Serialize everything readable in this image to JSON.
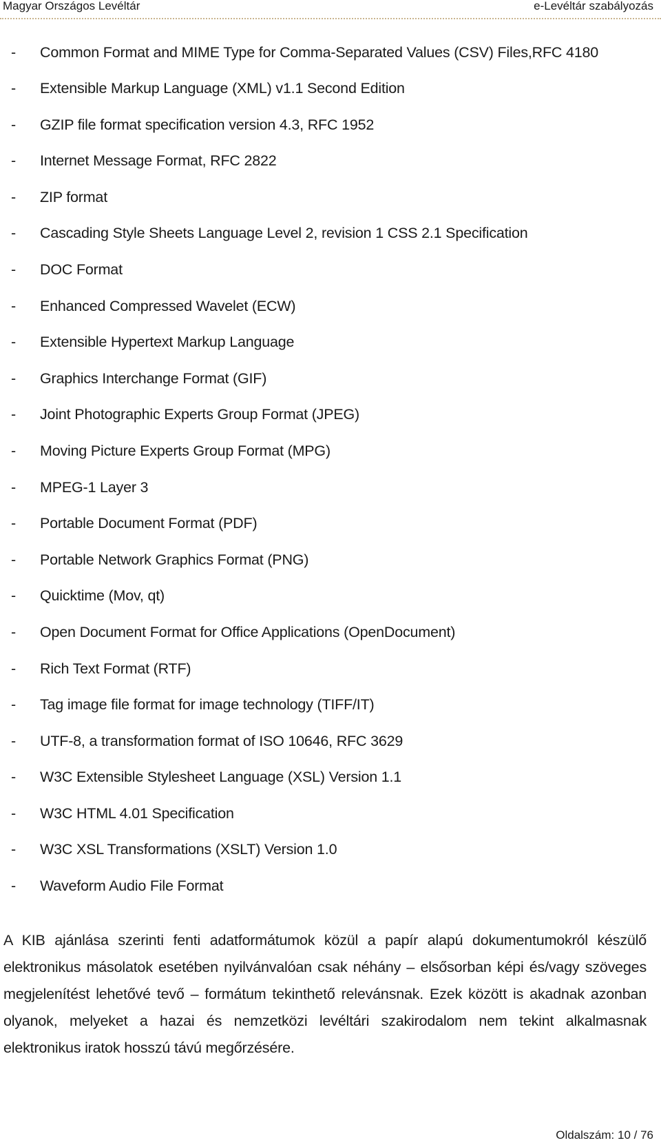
{
  "header": {
    "left": "Magyar Országos Levéltár",
    "right": "e-Levéltár szabályozás",
    "rule_color": "#c9b48f"
  },
  "list": {
    "bullet": "-",
    "items": [
      "Common Format and MIME Type for Comma-Separated Values (CSV) Files,RFC 4180",
      "Extensible Markup Language (XML) v1.1 Second Edition",
      "GZIP file format specification version 4.3, RFC 1952",
      "Internet Message Format, RFC 2822",
      "ZIP format",
      "Cascading Style Sheets Language Level 2, revision 1 CSS 2.1 Specification",
      "DOC Format",
      "Enhanced Compressed Wavelet (ECW)",
      "Extensible Hypertext Markup Language",
      "Graphics Interchange Format (GIF)",
      "Joint Photographic Experts Group Format (JPEG)",
      "Moving Picture Experts Group Format (MPG)",
      "MPEG-1 Layer 3",
      "Portable Document Format (PDF)",
      "Portable Network Graphics Format (PNG)",
      "Quicktime (Mov, qt)",
      "Open Document Format for Office Applications (OpenDocument)",
      "Rich Text Format (RTF)",
      "Tag image file format for image technology (TIFF/IT)",
      "UTF-8, a transformation format of ISO 10646, RFC 3629",
      "W3C Extensible Stylesheet Language (XSL) Version 1.1",
      "W3C HTML 4.01 Specification",
      "W3C XSL Transformations (XSLT) Version 1.0",
      "Waveform Audio File Format"
    ]
  },
  "paragraph": "A KIB ajánlása szerinti fenti adatformátumok közül a papír alapú dokumentumokról készülő elektronikus másolatok esetében nyilvánvalóan csak néhány – elsősorban képi és/vagy szöveges megjelenítést lehetővé tevő – formátum tekinthető relevánsnak. Ezek között is akadnak azonban olyanok, melyeket a hazai és nemzetközi levéltári szakirodalom nem tekint alkalmasnak elektronikus iratok hosszú távú megőrzésére.",
  "footer": {
    "page_label": "Oldalszám: 10 / 76"
  }
}
